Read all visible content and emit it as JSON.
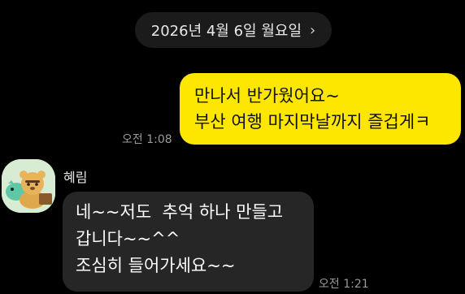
{
  "date_divider": {
    "label": "2026년 4월 6일 월요일",
    "icon": "chevron-right-icon"
  },
  "messages": [
    {
      "direction": "outgoing",
      "lines": [
        "만나서 반가웠어요~",
        "부산 여행 마지막날까지 즐겁게ㅋ"
      ],
      "time": "오전 1:08"
    },
    {
      "direction": "incoming",
      "sender": "혜림",
      "lines": [
        "네~~저도  추억 하나 만들고",
        "갑니다~~^^",
        "조심히 들어가세요~~"
      ],
      "time": "오전 1:21"
    }
  ],
  "colors": {
    "background": "#000000",
    "outgoing_bubble": "#fde600",
    "incoming_bubble": "#262626",
    "date_pill": "#1b1b1b",
    "timestamp": "#9a9a9a"
  }
}
